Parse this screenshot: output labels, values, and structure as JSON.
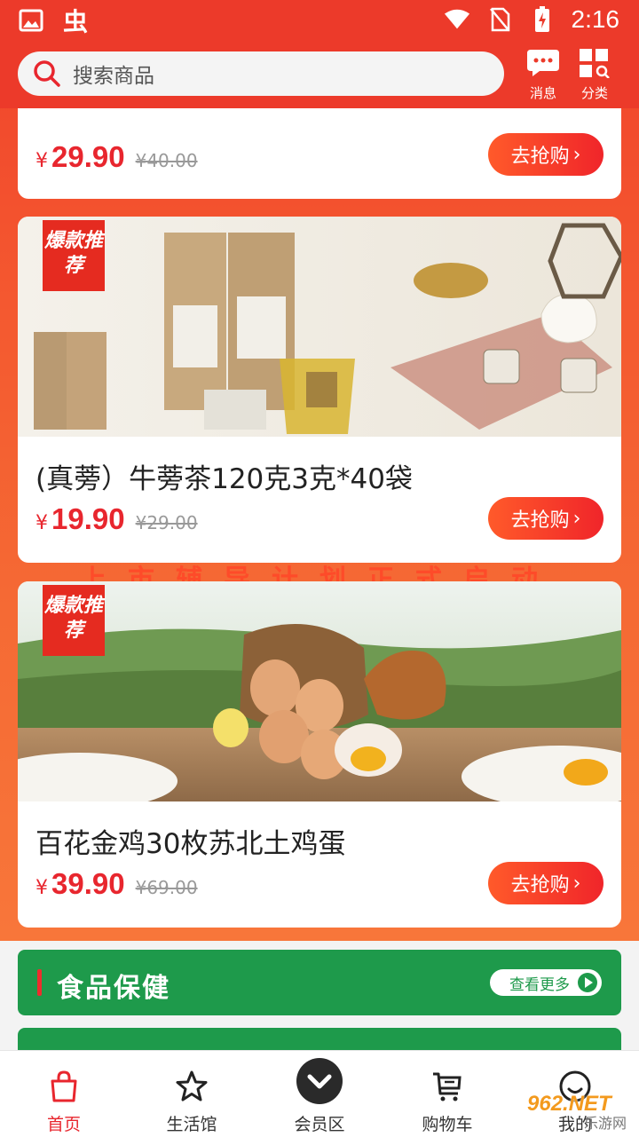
{
  "status_bar": {
    "time": "2:16"
  },
  "header": {
    "search_placeholder": "搜索商品",
    "messages_label": "消息",
    "category_label": "分类"
  },
  "promo_banner_text": "上市辅导计划正式启动",
  "products": [
    {
      "title": "",
      "currency": "¥",
      "price": "29.90",
      "original_price": "¥40.00",
      "buy_label": "去抢购",
      "badge": ""
    },
    {
      "title": "(真蒡）牛蒡茶120克3克*40袋",
      "currency": "¥",
      "price": "19.90",
      "original_price": "¥29.00",
      "buy_label": "去抢购",
      "badge": "爆款推荐"
    },
    {
      "title": "百花金鸡30枚苏北土鸡蛋",
      "currency": "¥",
      "price": "39.90",
      "original_price": "¥69.00",
      "buy_label": "去抢购",
      "badge": "爆款推荐"
    }
  ],
  "section": {
    "title": "食品保健",
    "more_label": "查看更多"
  },
  "nav": [
    {
      "label": "首页",
      "icon": "bag-icon",
      "active": true
    },
    {
      "label": "生活馆",
      "icon": "star-icon",
      "active": false
    },
    {
      "label": "会员区",
      "icon": "chevron-circle-icon",
      "active": false
    },
    {
      "label": "购物车",
      "icon": "cart-icon",
      "active": false
    },
    {
      "label": "我的",
      "icon": "smile-icon",
      "active": false
    }
  ],
  "watermark": {
    "brand": "962.NET",
    "sub": "乐游网"
  },
  "colors": {
    "primary": "#ec3a2a",
    "price": "#e8262e",
    "section": "#1e9a4b"
  }
}
